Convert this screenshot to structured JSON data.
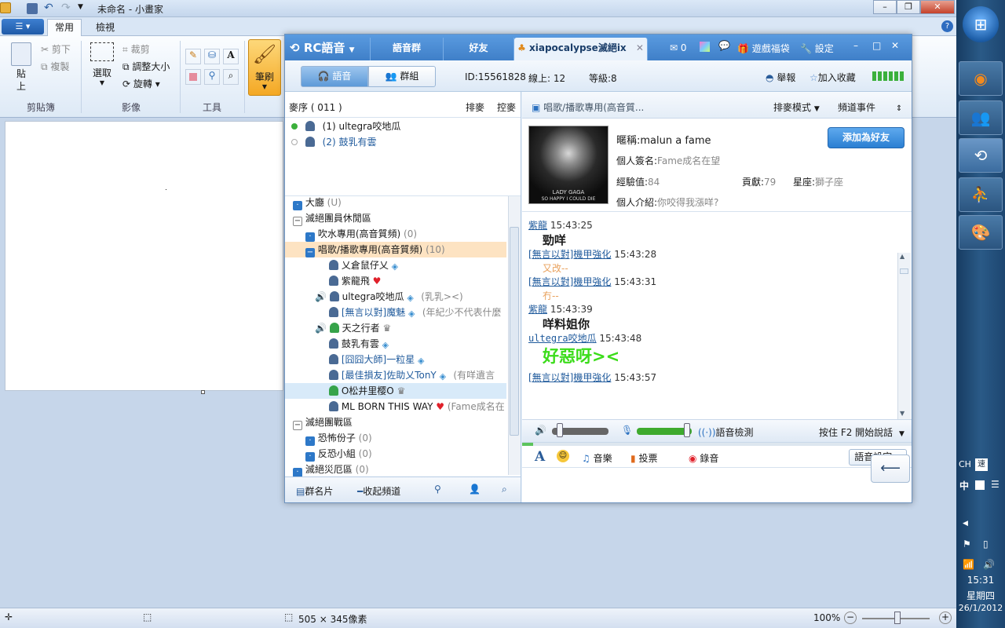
{
  "paint": {
    "title": "未命名 - 小畫家",
    "tabs": [
      "常用",
      "檢視"
    ],
    "clipboard": {
      "paste": "貼上",
      "cut": "剪下",
      "copy": "複製",
      "label": "剪貼簿"
    },
    "image": {
      "select": "選取",
      "crop": "裁剪",
      "resize": "調整大小",
      "rotate": "旋轉",
      "label": "影像"
    },
    "tools": {
      "label": "工具"
    },
    "brushes": "筆刷",
    "status": {
      "size": "505 × 345像素",
      "zoom": "100%"
    }
  },
  "taskbar": {
    "lang": "CH",
    "ime": "中",
    "time": "15:31",
    "weekday": "星期四",
    "date": "26/1/2012"
  },
  "rc": {
    "logo": "RC語音",
    "tabs": [
      "語音群",
      "好友",
      "xiapocalypse滅絕ix"
    ],
    "mail_count": "0",
    "head_actions": [
      "遊戲福袋",
      "設定"
    ],
    "mode_tabs": [
      "語音",
      "群組"
    ],
    "id": "ID:15561828",
    "online": "線上: 12",
    "level": "等級:8",
    "report": "舉報",
    "favorite": "加入收藏",
    "queue": {
      "title": "麥序 ( 011 )",
      "sort": "排麥",
      "control": "控麥",
      "items": [
        "(1) ultegra咬地瓜",
        "(2) 鼓乳有雲"
      ]
    },
    "tree": [
      {
        "t": "大廳",
        "extra": "(U)"
      },
      {
        "t": "滅絕團員休閒區"
      },
      {
        "t": "吹水專用(高音質頻)",
        "extra": "(0)"
      },
      {
        "t": "唱歌/播歌專用(高音質頻)",
        "extra": "(10)"
      },
      {
        "t": "乂倉鼠仔乂"
      },
      {
        "t": "紫龍飛"
      },
      {
        "t": "ultegra咬地瓜",
        "extra": "(乳乳><)"
      },
      {
        "t": "[無言以對]魔魅",
        "extra": "(年紀少不代表什麼"
      },
      {
        "t": "天之行者"
      },
      {
        "t": "鼓乳有雲"
      },
      {
        "t": "[囧囧大師]一粒星"
      },
      {
        "t": "[最佳損友]佐助乂TonY",
        "extra": "(有咩遺言"
      },
      {
        "t": "O松井里樱O"
      },
      {
        "t": "ML BORN THIS WAY",
        "extra": "(Fame成名在"
      },
      {
        "t": "滅絕團戰區"
      },
      {
        "t": "恐怖份子",
        "extra": "(0)"
      },
      {
        "t": "反恐小組",
        "extra": "(0)"
      },
      {
        "t": "滅絕災厄區",
        "extra": "(0)"
      }
    ],
    "bottom_left": [
      "群名片",
      "收起頻道"
    ],
    "channel": {
      "name": "唱歌/播歌專用(高音質...",
      "mode": "排麥模式",
      "events": "頻道事件"
    },
    "profile": {
      "album_line1": "LADY GAGA",
      "album_line2": "SO HAPPY I COULD DIE",
      "nick_label": "暱稱:",
      "nick": "malun a fame",
      "sig_label": "個人簽名:",
      "sig": "Fame成名在望",
      "exp_label": "經驗值:",
      "exp": "84",
      "contrib_label": "貢獻:",
      "contrib": "79",
      "star_label": "星座:",
      "star": "獅子座",
      "intro_label": "個人介紹:",
      "intro": "你咬得我漲咩?",
      "add_friend": "添加為好友"
    },
    "chat": [
      {
        "name": "紫龍",
        "time": "15:43:25",
        "msg": "勁咩",
        "style": "bold"
      },
      {
        "name": "[無言以對]機甲強化",
        "time": "15:43:28",
        "msg": "又改--",
        "style": "orange"
      },
      {
        "name": "[無言以對]機甲強化",
        "time": "15:43:31",
        "msg": "冇--",
        "style": "orange"
      },
      {
        "name": "紫龍",
        "time": "15:43:39",
        "msg": "咩料姐你",
        "style": "bold"
      },
      {
        "name": "ultegra咬地瓜",
        "time": "15:43:48",
        "msg": "好惡呀><",
        "style": "green"
      },
      {
        "name": "[無言以對]機甲強化",
        "time": "15:43:57",
        "msg": "",
        "style": ""
      }
    ],
    "voice": {
      "detect": "語音檢測",
      "ptt": "按住 F2 開始說話",
      "speaker_level": 0.15,
      "mic_level": 0.95
    },
    "tools": [
      "音樂",
      "投票",
      "錄音"
    ],
    "voice_settings": "語音設定",
    "colors": {
      "accent": "#3f7fc8",
      "selected": "#fde3c2",
      "link": "#1f5a9c"
    }
  }
}
